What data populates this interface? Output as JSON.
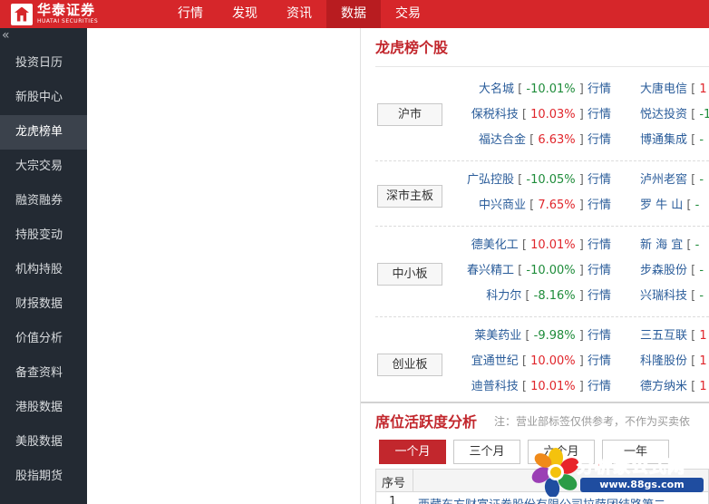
{
  "brand": {
    "name_cn": "华泰证券",
    "name_en": "HUATAI SECURITIES"
  },
  "nav": [
    {
      "label": "行情",
      "active": false
    },
    {
      "label": "发现",
      "active": false
    },
    {
      "label": "资讯",
      "active": false
    },
    {
      "label": "数据",
      "active": true
    },
    {
      "label": "交易",
      "active": false
    }
  ],
  "sidebar": {
    "collapse_glyph": "«",
    "items": [
      {
        "label": "投资日历"
      },
      {
        "label": "新股中心"
      },
      {
        "label": "龙虎榜单",
        "active": true
      },
      {
        "label": "大宗交易"
      },
      {
        "label": "融资融券"
      },
      {
        "label": "持股变动"
      },
      {
        "label": "机构持股"
      },
      {
        "label": "财报数据"
      },
      {
        "label": "价值分析"
      },
      {
        "label": "备查资料"
      },
      {
        "label": "港股数据"
      },
      {
        "label": "美股数据"
      },
      {
        "label": "股指期货"
      }
    ]
  },
  "lhb": {
    "title": "龙虎榜个股",
    "hq_label": "行情",
    "groups": [
      {
        "market": "沪市",
        "left": [
          {
            "name": "大名城",
            "pct": "-10.01%"
          },
          {
            "name": "保税科技",
            "pct": "10.03%"
          },
          {
            "name": "福达合金",
            "pct": "6.63%"
          }
        ],
        "right": [
          {
            "name": "大唐电信",
            "pct": "1"
          },
          {
            "name": "悦达投资",
            "pct": "-1"
          },
          {
            "name": "博通集成",
            "pct": "-"
          }
        ]
      },
      {
        "market": "深市主板",
        "left": [
          {
            "name": "广弘控股",
            "pct": "-10.05%"
          },
          {
            "name": "中兴商业",
            "pct": "7.65%"
          }
        ],
        "right": [
          {
            "name": "泸州老窖",
            "pct": "-"
          },
          {
            "name": "罗 牛 山",
            "pct": "-"
          }
        ]
      },
      {
        "market": "中小板",
        "left": [
          {
            "name": "德美化工",
            "pct": "10.01%"
          },
          {
            "name": "春兴精工",
            "pct": "-10.00%"
          },
          {
            "name": "科力尔",
            "pct": "-8.16%"
          }
        ],
        "right": [
          {
            "name": "新 海 宜",
            "pct": "-"
          },
          {
            "name": "步森股份",
            "pct": "-"
          },
          {
            "name": "兴瑞科技",
            "pct": "-"
          }
        ]
      },
      {
        "market": "创业板",
        "left": [
          {
            "name": "莱美药业",
            "pct": "-9.98%"
          },
          {
            "name": "宜通世纪",
            "pct": "10.00%"
          },
          {
            "name": "迪普科技",
            "pct": "10.01%"
          }
        ],
        "right": [
          {
            "name": "三五互联",
            "pct": "1"
          },
          {
            "name": "科隆股份",
            "pct": "1"
          },
          {
            "name": "德方纳米",
            "pct": "1"
          }
        ]
      }
    ]
  },
  "seat": {
    "title": "席位活跃度分析",
    "note": "注：营业部标签仅供参考，不作为买卖依",
    "tabs": [
      {
        "label": "一个月",
        "active": true
      },
      {
        "label": "三个月",
        "active": false
      },
      {
        "label": "六个月",
        "active": false
      },
      {
        "label": "一年",
        "active": false
      }
    ],
    "table": {
      "headers": [
        "序号"
      ],
      "rows": [
        {
          "no": "1",
          "name": "西藏东方财富证券股份有限公司拉萨团结路第二"
        }
      ]
    }
  },
  "watermark": {
    "text": "分析家公式网",
    "url": "www.88gs.com"
  },
  "colors": {
    "brand_red": "#d6262a",
    "up": "#e0252b",
    "down": "#1e8c3a",
    "sidebar_bg": "#232a33"
  }
}
